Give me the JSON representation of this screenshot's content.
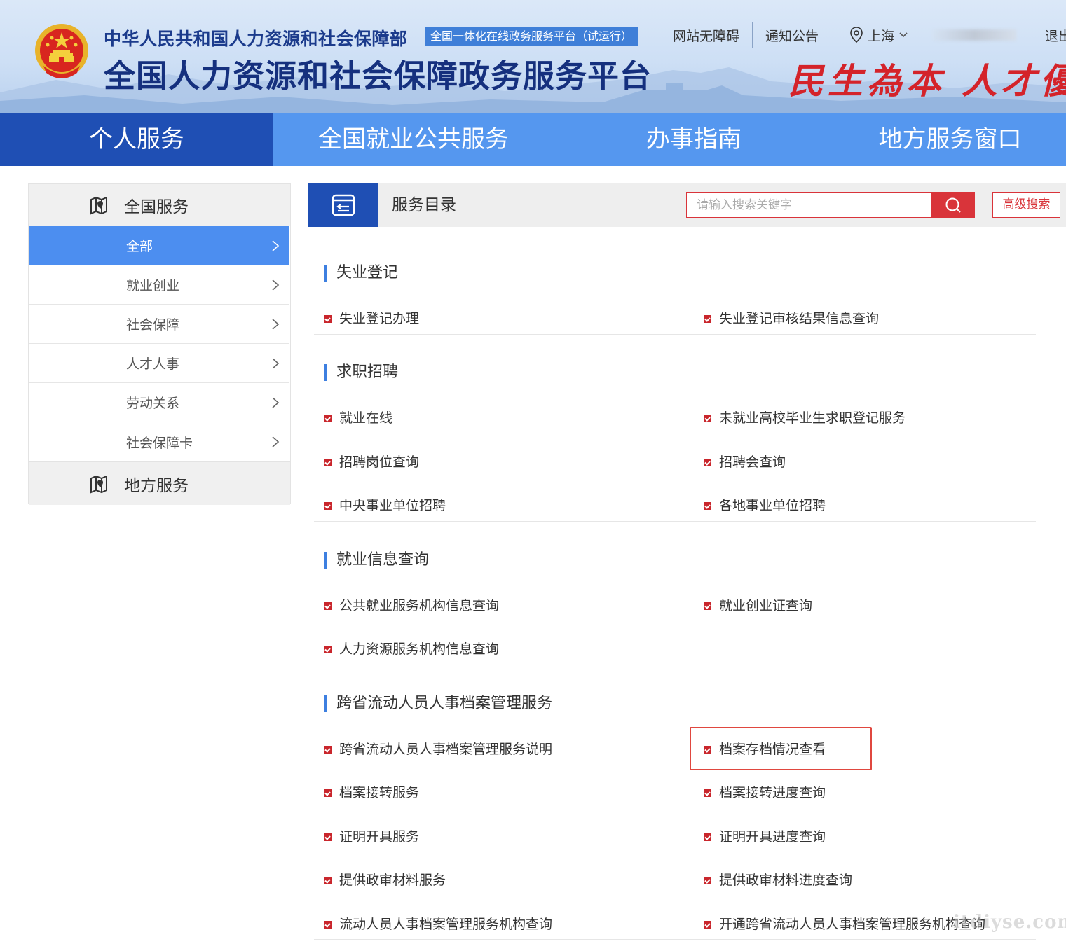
{
  "header": {
    "ministry_name": "中华人民共和国人力资源和社会保障部",
    "trial_badge": "全国一体化在线政务服务平台（试运行）",
    "platform_title": "全国人力资源和社会保障政务服务平台",
    "slogan": "民生為本 人才優先",
    "links": {
      "accessibility": "网站无障碍",
      "notices": "通知公告",
      "location": "上海",
      "logout": "退出"
    }
  },
  "nav": [
    "个人服务",
    "全国就业公共服务",
    "办事指南",
    "地方服务窗口"
  ],
  "sidebar": {
    "national_title": "全国服务",
    "items": [
      {
        "label": "全部"
      },
      {
        "label": "就业创业"
      },
      {
        "label": "社会保障"
      },
      {
        "label": "人才人事"
      },
      {
        "label": "劳动关系"
      },
      {
        "label": "社会保障卡"
      }
    ],
    "local_title": "地方服务"
  },
  "catalog": {
    "title": "服务目录",
    "search_placeholder": "请输入搜索关键字",
    "advanced_search": "高级搜索"
  },
  "sections": [
    {
      "title": "失业登记",
      "items": [
        "失业登记办理",
        "失业登记审核结果信息查询"
      ]
    },
    {
      "title": "求职招聘",
      "items": [
        "就业在线",
        "未就业高校毕业生求职登记服务",
        "招聘岗位查询",
        "招聘会查询",
        "中央事业单位招聘",
        "各地事业单位招聘"
      ]
    },
    {
      "title": "就业信息查询",
      "items": [
        "公共就业服务机构信息查询",
        "就业创业证查询",
        "人力资源服务机构信息查询"
      ]
    },
    {
      "title": "跨省流动人员人事档案管理服务",
      "items": [
        "跨省流动人员人事档案管理服务说明",
        "档案存档情况查看",
        "档案接转服务",
        "档案接转进度查询",
        "证明开具服务",
        "证明开具进度查询",
        "提供政审材料服务",
        "提供政审材料进度查询",
        "流动人员人事档案管理服务机构查询",
        "开通跨省流动人员人事档案管理服务机构查询"
      ]
    }
  ],
  "watermark": "itdiyse.com",
  "colors": {
    "nav_active": "#1f4fb4",
    "nav_bg": "#5597ef",
    "sidebar_active": "#4c8ef0",
    "accent_red": "#d9343a",
    "section_bar": "#3d7fe0"
  }
}
